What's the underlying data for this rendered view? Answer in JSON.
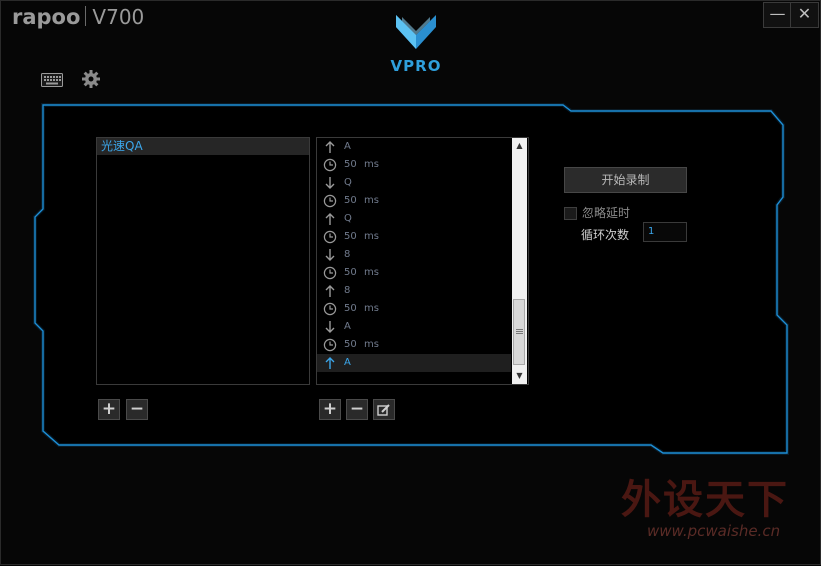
{
  "app": {
    "brand": "rapoo",
    "model": "V700",
    "logo_text": "VPRO",
    "minimize_label": "—",
    "close_label": "✕"
  },
  "toolbar": {
    "keyboard_icon": "keyboard-icon",
    "settings_icon": "gear-icon"
  },
  "macro_list": {
    "items": [
      "光速QA"
    ]
  },
  "event_list": {
    "rows": [
      {
        "icon": "arrow-up",
        "label": "A",
        "unit": ""
      },
      {
        "icon": "clock",
        "label": "50",
        "unit": "ms"
      },
      {
        "icon": "arrow-down",
        "label": "Q",
        "unit": ""
      },
      {
        "icon": "clock",
        "label": "50",
        "unit": "ms"
      },
      {
        "icon": "arrow-up",
        "label": "Q",
        "unit": ""
      },
      {
        "icon": "clock",
        "label": "50",
        "unit": "ms"
      },
      {
        "icon": "arrow-down",
        "label": "8",
        "unit": ""
      },
      {
        "icon": "clock",
        "label": "50",
        "unit": "ms"
      },
      {
        "icon": "arrow-up",
        "label": "8",
        "unit": ""
      },
      {
        "icon": "clock",
        "label": "50",
        "unit": "ms"
      },
      {
        "icon": "arrow-down",
        "label": "A",
        "unit": ""
      },
      {
        "icon": "clock",
        "label": "50",
        "unit": "ms"
      },
      {
        "icon": "arrow-up",
        "label": "A",
        "unit": "",
        "selected": true
      }
    ]
  },
  "macro_buttons": {
    "add": "+",
    "remove": "−"
  },
  "event_buttons": {
    "add": "+",
    "remove": "−",
    "edit_icon": "edit-icon"
  },
  "controls": {
    "record_label": "开始录制",
    "ignore_delay_label": "忽略延时",
    "ignore_delay_checked": false,
    "loop_label": "循环次数",
    "loop_value": "1"
  },
  "watermark": {
    "text": "外设天下",
    "url": "www.pcwaishe.cn"
  },
  "colors": {
    "accent": "#3ba6ea",
    "frame": "#1e8fd6",
    "background": "#050505"
  }
}
